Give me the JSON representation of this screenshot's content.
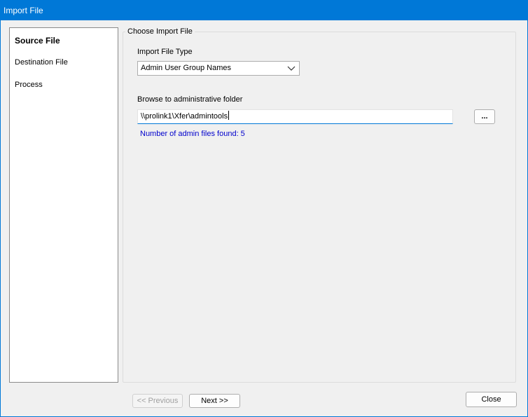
{
  "window": {
    "title": "Import File"
  },
  "steps": [
    {
      "label": "Source File",
      "active": true
    },
    {
      "label": "Destination File",
      "active": false
    },
    {
      "label": "Process",
      "active": false
    }
  ],
  "group": {
    "title": "Choose Import File",
    "file_type_label": "Import File Type",
    "file_type_value": "Admin User Group Names",
    "browse_label": "Browse to administrative folder",
    "folder_path": "\\\\prolink1\\Xfer\\admintools",
    "browse_button": "...",
    "files_found": "Number of admin files found: 5"
  },
  "footer": {
    "previous_label": "<< Previous",
    "next_label": "Next >>",
    "close_label": "Close"
  },
  "colors": {
    "titlebar": "#0078d7",
    "status_text": "#0000cc"
  }
}
